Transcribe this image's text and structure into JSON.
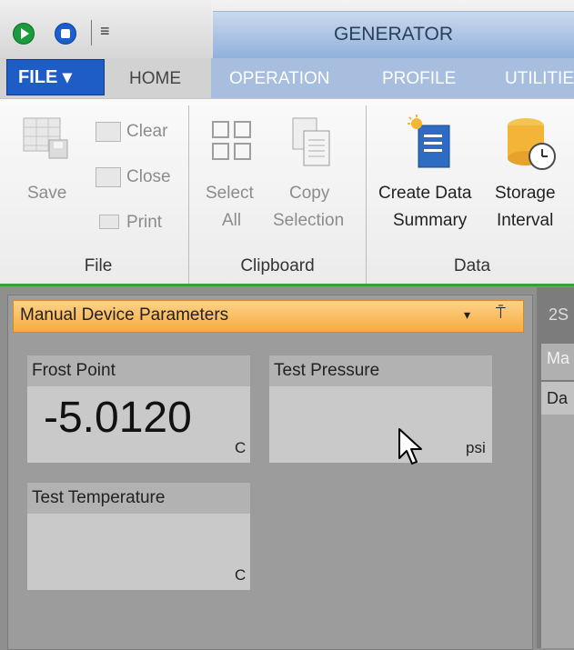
{
  "quick_access": {
    "play_icon": "play-circle-icon",
    "stop_icon": "stop-circle-icon",
    "customize_glyph": "≡"
  },
  "window": {
    "context_title": "GENERATOR"
  },
  "tabs": {
    "file": "FILE ▾",
    "home": "HOME",
    "operation": "OPERATION",
    "profile": "PROFILE",
    "utilities": "UTILITIE"
  },
  "ribbon": {
    "file_group": {
      "label": "File",
      "save": "Save",
      "clear": "Clear",
      "close": "Close",
      "print": "Print"
    },
    "clipboard_group": {
      "label": "Clipboard",
      "select_all_line1": "Select",
      "select_all_line2": "All",
      "copy_line1": "Copy",
      "copy_line2": "Selection"
    },
    "data_group": {
      "label": "Data",
      "create_line1": "Create Data",
      "create_line2": "Summary",
      "storage_line1": "Storage",
      "storage_line2": "Interval"
    }
  },
  "panel": {
    "title": "Manual Device Parameters",
    "dropdown_glyph": "▾",
    "pin_glyph": "⍑",
    "params": {
      "frost_point": {
        "label": "Frost Point",
        "value": "-5.0120",
        "unit": "C"
      },
      "test_pressure": {
        "label": "Test Pressure",
        "value": "",
        "unit": "psi"
      },
      "test_temperature": {
        "label": "Test Temperature",
        "value": "",
        "unit": "C"
      }
    }
  },
  "right_pane": {
    "tab": "2S",
    "row1": "Ma",
    "row2": "Da"
  },
  "colors": {
    "accent_blue": "#1e5cc6",
    "panel_header_orange": "#f6ac3e",
    "ribbon_green_line": "#3a9e3a"
  }
}
